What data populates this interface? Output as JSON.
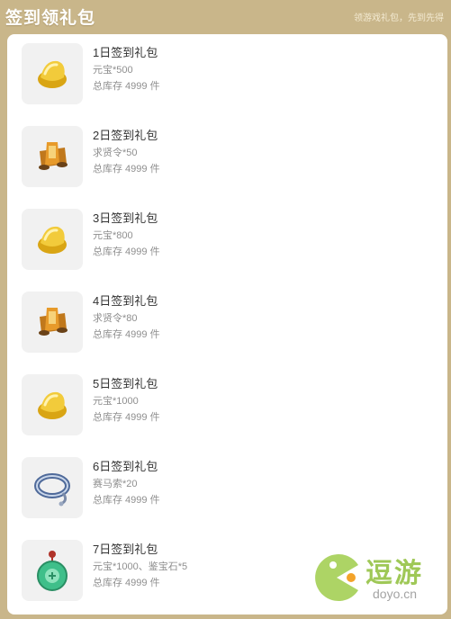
{
  "header": {
    "title": "签到领礼包",
    "hint": "领游戏礼包，先到先得"
  },
  "items": [
    {
      "name": "1日签到礼包",
      "desc": "元宝*500",
      "stock": "总库存 4999 件",
      "icon": "gold-ingot-icon"
    },
    {
      "name": "2日签到礼包",
      "desc": "求贤令*50",
      "stock": "总库存 4999 件",
      "icon": "recruit-token-icon"
    },
    {
      "name": "3日签到礼包",
      "desc": "元宝*800",
      "stock": "总库存 4999 件",
      "icon": "gold-ingot-icon"
    },
    {
      "name": "4日签到礼包",
      "desc": "求贤令*80",
      "stock": "总库存 4999 件",
      "icon": "recruit-token-icon"
    },
    {
      "name": "5日签到礼包",
      "desc": "元宝*1000",
      "stock": "总库存 4999 件",
      "icon": "gold-ingot-icon"
    },
    {
      "name": "6日签到礼包",
      "desc": "赛马索*20",
      "stock": "总库存 4999 件",
      "icon": "horse-lasso-icon"
    },
    {
      "name": "7日签到礼包",
      "desc": "元宝*1000、鉴宝石*5",
      "stock": "总库存 4999 件",
      "icon": "appraisal-stone-icon"
    }
  ],
  "watermark": {
    "brand": "逗游",
    "domain": "doyo.cn"
  },
  "colors": {
    "frame": "#c9b68a",
    "panel": "#ffffff",
    "thumb_bg": "#f1f1f1"
  }
}
